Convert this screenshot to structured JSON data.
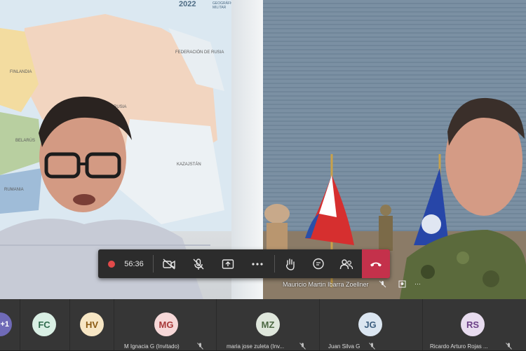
{
  "left_video": {
    "map_year": "2022",
    "map_sub": "GEOGRÁFICO MILITAR",
    "map_labels": [
      "FEDERACIÓN DE RUSIA",
      "FINLANDIA",
      "RUSIA",
      "KAZAJSTÁN",
      "RUMANIA",
      "BELARÚS"
    ]
  },
  "right_video": {
    "participant_name": "Mauricio Martin Ibarra Zoellner",
    "mic_icon": "mic-off-icon",
    "pin_icon": "pin-icon",
    "more_icon": "more-icon"
  },
  "toolbar": {
    "timer": "56:36",
    "colors": {
      "record": "#e24a4a",
      "hangup": "#c4314b",
      "bg": "#2c2c2c"
    },
    "icons": [
      "recording-icon",
      "camera-off-icon",
      "mic-off-icon",
      "share-icon",
      "more-icon",
      "raise-hand-icon",
      "chat-icon",
      "participants-icon",
      "hang-up-icon"
    ]
  },
  "participants": [
    {
      "initials": "+1",
      "name": "",
      "bg": "#6f6ab7",
      "fg": "#ffffff"
    },
    {
      "initials": "FC",
      "name": "",
      "bg": "#d9efe4",
      "fg": "#2f6b4d"
    },
    {
      "initials": "HV",
      "name": "",
      "bg": "#f7e6c4",
      "fg": "#8a5a12"
    },
    {
      "initials": "MG",
      "name": "M Ignacia G (Invitado)",
      "bg": "#f6d8d8",
      "fg": "#a83a3a"
    },
    {
      "initials": "MZ",
      "name": "maria jose zuleta (Inv...",
      "bg": "#dfe7dc",
      "fg": "#4c6843"
    },
    {
      "initials": "JG",
      "name": "Juan Silva G",
      "bg": "#dbe6f1",
      "fg": "#3d5f80"
    },
    {
      "initials": "RS",
      "name": "Ricardo Arturo Rojas ...",
      "bg": "#e8dcef",
      "fg": "#6b3f86"
    }
  ]
}
